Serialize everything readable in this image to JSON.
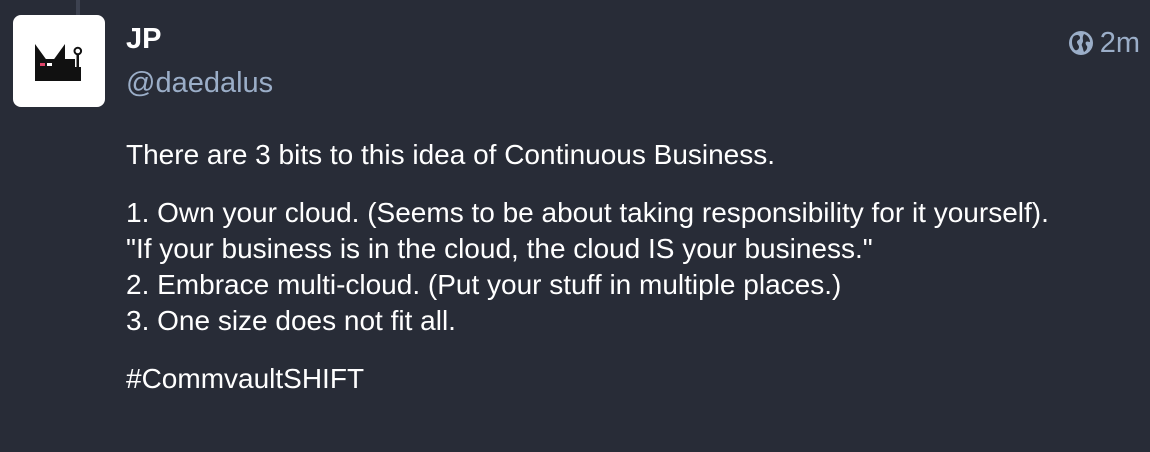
{
  "post": {
    "display_name": "JP",
    "handle": "@daedalus",
    "visibility_icon": "globe-icon",
    "timestamp": "2m",
    "paragraph_1": "There are 3 bits to this idea of Continuous Business.",
    "list_lines": [
      "1. Own your cloud. (Seems to be about taking responsibility for it yourself).",
      "\"If your business is in the cloud, the cloud IS your business.\"",
      "2. Embrace multi-cloud. (Put your stuff in multiple places.)",
      "3. One size does not fit all."
    ],
    "hashtag": "#CommvaultSHIFT"
  },
  "colors": {
    "background": "#282c37",
    "text": "#ffffff",
    "secondary_text": "#9baec8",
    "avatar_bg": "#ffffff"
  }
}
